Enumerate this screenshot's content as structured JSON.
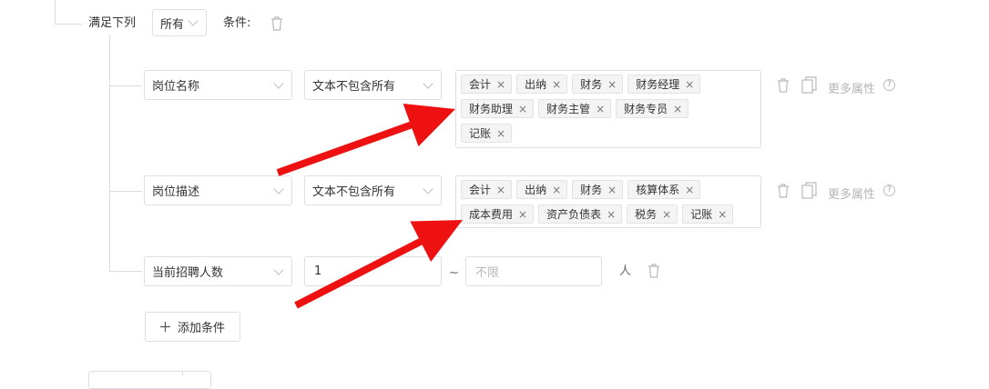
{
  "header": {
    "satisfy_label": "满足下列",
    "match_value": "所有",
    "condition_label": "条件:"
  },
  "rows": [
    {
      "field": "岗位名称",
      "operator": "文本不包含所有",
      "tags": [
        "会计",
        "出纳",
        "财务",
        "财务经理",
        "财务助理",
        "财务主管",
        "财务专员",
        "记账"
      ],
      "more_label": "更多属性"
    },
    {
      "field": "岗位描述",
      "operator": "文本不包含所有",
      "tags": [
        "会计",
        "出纳",
        "财务",
        "核算体系",
        "成本费用",
        "资产负债表",
        "税务",
        "记账"
      ],
      "more_label": "更多属性"
    },
    {
      "field": "当前招聘人数",
      "min_value": "1",
      "range_sep": "~",
      "max_placeholder": "不限",
      "unit": "人"
    }
  ],
  "add_condition_label": "添加条件",
  "tag_remove_glyph": "×",
  "help_glyph": "?",
  "annotation": {
    "arrow_color": "#ee1111"
  }
}
